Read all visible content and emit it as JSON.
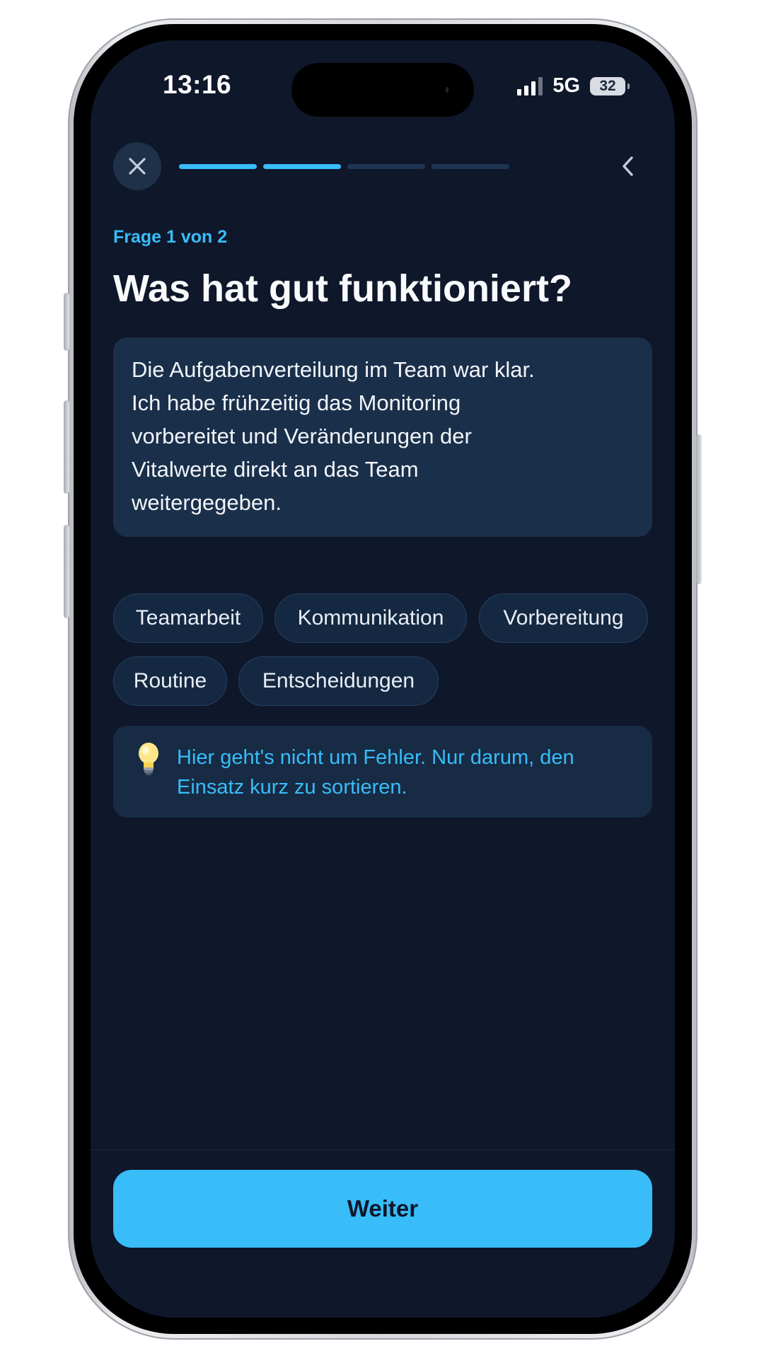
{
  "status_bar": {
    "time": "13:16",
    "network": "5G",
    "battery": "32"
  },
  "nav": {
    "close_icon": "close-x-icon",
    "back_icon": "chevron-left-icon",
    "progress": {
      "total_segments": 4,
      "completed_segments": 2,
      "active_color": "#38bdf8",
      "inactive_color": "#1e3552"
    }
  },
  "question": {
    "step_label": "Frage 1 von 2",
    "title": "Was hat gut funktioniert?"
  },
  "answer": {
    "text": "Die Aufgabenverteilung im Team war klar.\nIch habe frühzeitig das Monitoring\nvorbereitet und Veränderungen der\nVitalwerte direkt an das Team\nweitergegeben."
  },
  "chips": [
    {
      "label": "Teamarbeit"
    },
    {
      "label": "Kommunikation"
    },
    {
      "label": "Vorbereitung"
    },
    {
      "label": "Routine"
    },
    {
      "label": "Entscheidungen"
    }
  ],
  "hint": {
    "icon": "lightbulb-icon",
    "text": "Hier geht's nicht um Fehler. Nur darum, den Einsatz kurz zu sortieren."
  },
  "footer": {
    "continue_label": "Weiter"
  },
  "colors": {
    "background": "#0f172a",
    "accent": "#38bdf8",
    "card": "#1a2f4a"
  }
}
